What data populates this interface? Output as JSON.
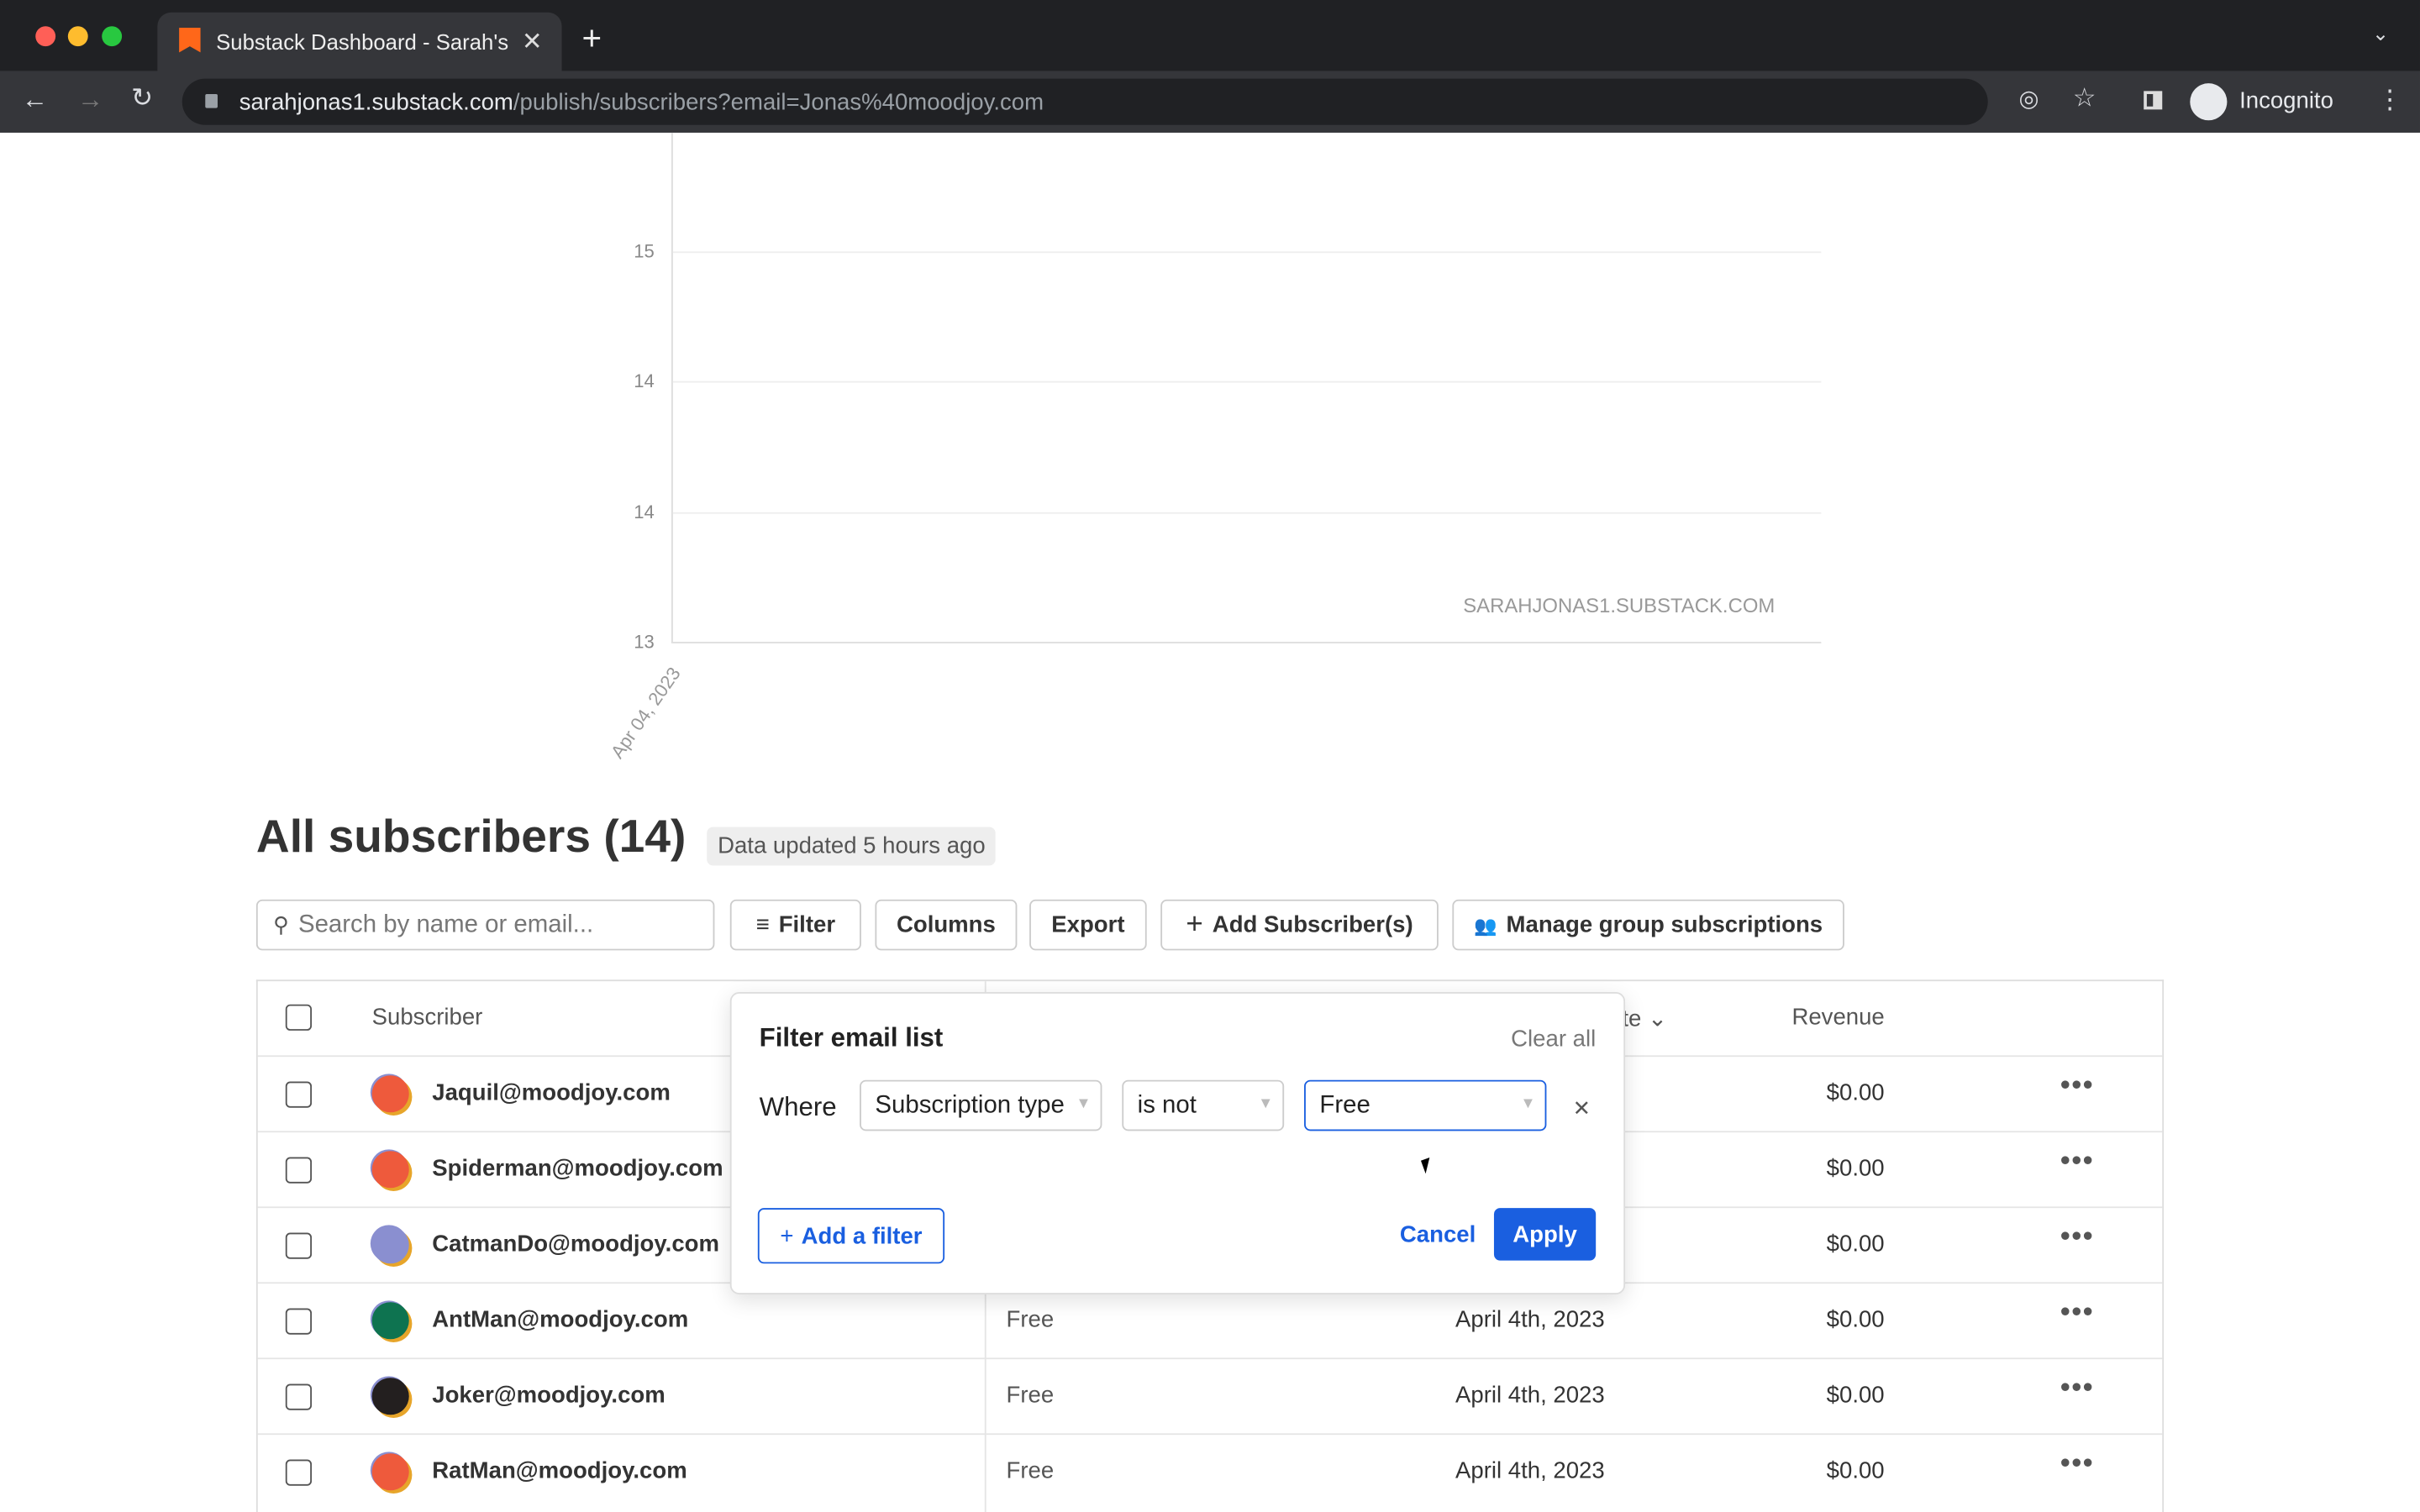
{
  "browser": {
    "tab_title": "Substack Dashboard - Sarah's",
    "url_host": "sarahjonas1.substack.com",
    "url_path": "/publish/subscribers?email=Jonas%40moodjoy.com",
    "profile": "Incognito",
    "accent": "#ff6719"
  },
  "chart_data": {
    "type": "line",
    "y_tick_labels": [
      "15",
      "14",
      "14",
      "13"
    ],
    "x_tick_labels": [
      "Apr 04, 2023"
    ],
    "watermark": "SARAHJONAS1.SUBSTACK.COM",
    "series": []
  },
  "main": {
    "title": "All subscribers (14)",
    "updated_badge": "Data updated 5 hours ago",
    "search_placeholder": "Search by name or email...",
    "toolbar": {
      "filter": "Filter",
      "columns": "Columns",
      "export": "Export",
      "add": "Add Subscriber(s)",
      "manage": "Manage group subscriptions"
    },
    "columns": {
      "subscriber": "Subscriber",
      "date_partial": "te",
      "revenue": "Revenue"
    },
    "rows": [
      {
        "email": "Jaquil@moodjoy.com",
        "type": "",
        "date": "",
        "revenue": "$0.00",
        "avatar": "#ee5a3c"
      },
      {
        "email": "Spiderman@moodjoy.com",
        "type": "",
        "date": "",
        "revenue": "$0.00",
        "avatar": "#ee5a3c"
      },
      {
        "email": "CatmanDo@moodjoy.com",
        "type": "",
        "date": "",
        "revenue": "$0.00",
        "avatar": "#8a8fd0"
      },
      {
        "email": "AntMan@moodjoy.com",
        "type": "Free",
        "date": "April 4th, 2023",
        "revenue": "$0.00",
        "avatar": "#0e7350"
      },
      {
        "email": "Joker@moodjoy.com",
        "type": "Free",
        "date": "April 4th, 2023",
        "revenue": "$0.00",
        "avatar": "#231f1f"
      },
      {
        "email": "RatMan@moodjoy.com",
        "type": "Free",
        "date": "April 4th, 2023",
        "revenue": "$0.00",
        "avatar": "#ee5a3c"
      }
    ]
  },
  "filter_popup": {
    "title": "Filter email list",
    "clear_all": "Clear all",
    "where": "Where",
    "field": "Subscription type",
    "operator": "is not",
    "value": "Free",
    "add_filter": "Add a filter",
    "cancel": "Cancel",
    "apply": "Apply",
    "primary": "#1a5fe0"
  }
}
